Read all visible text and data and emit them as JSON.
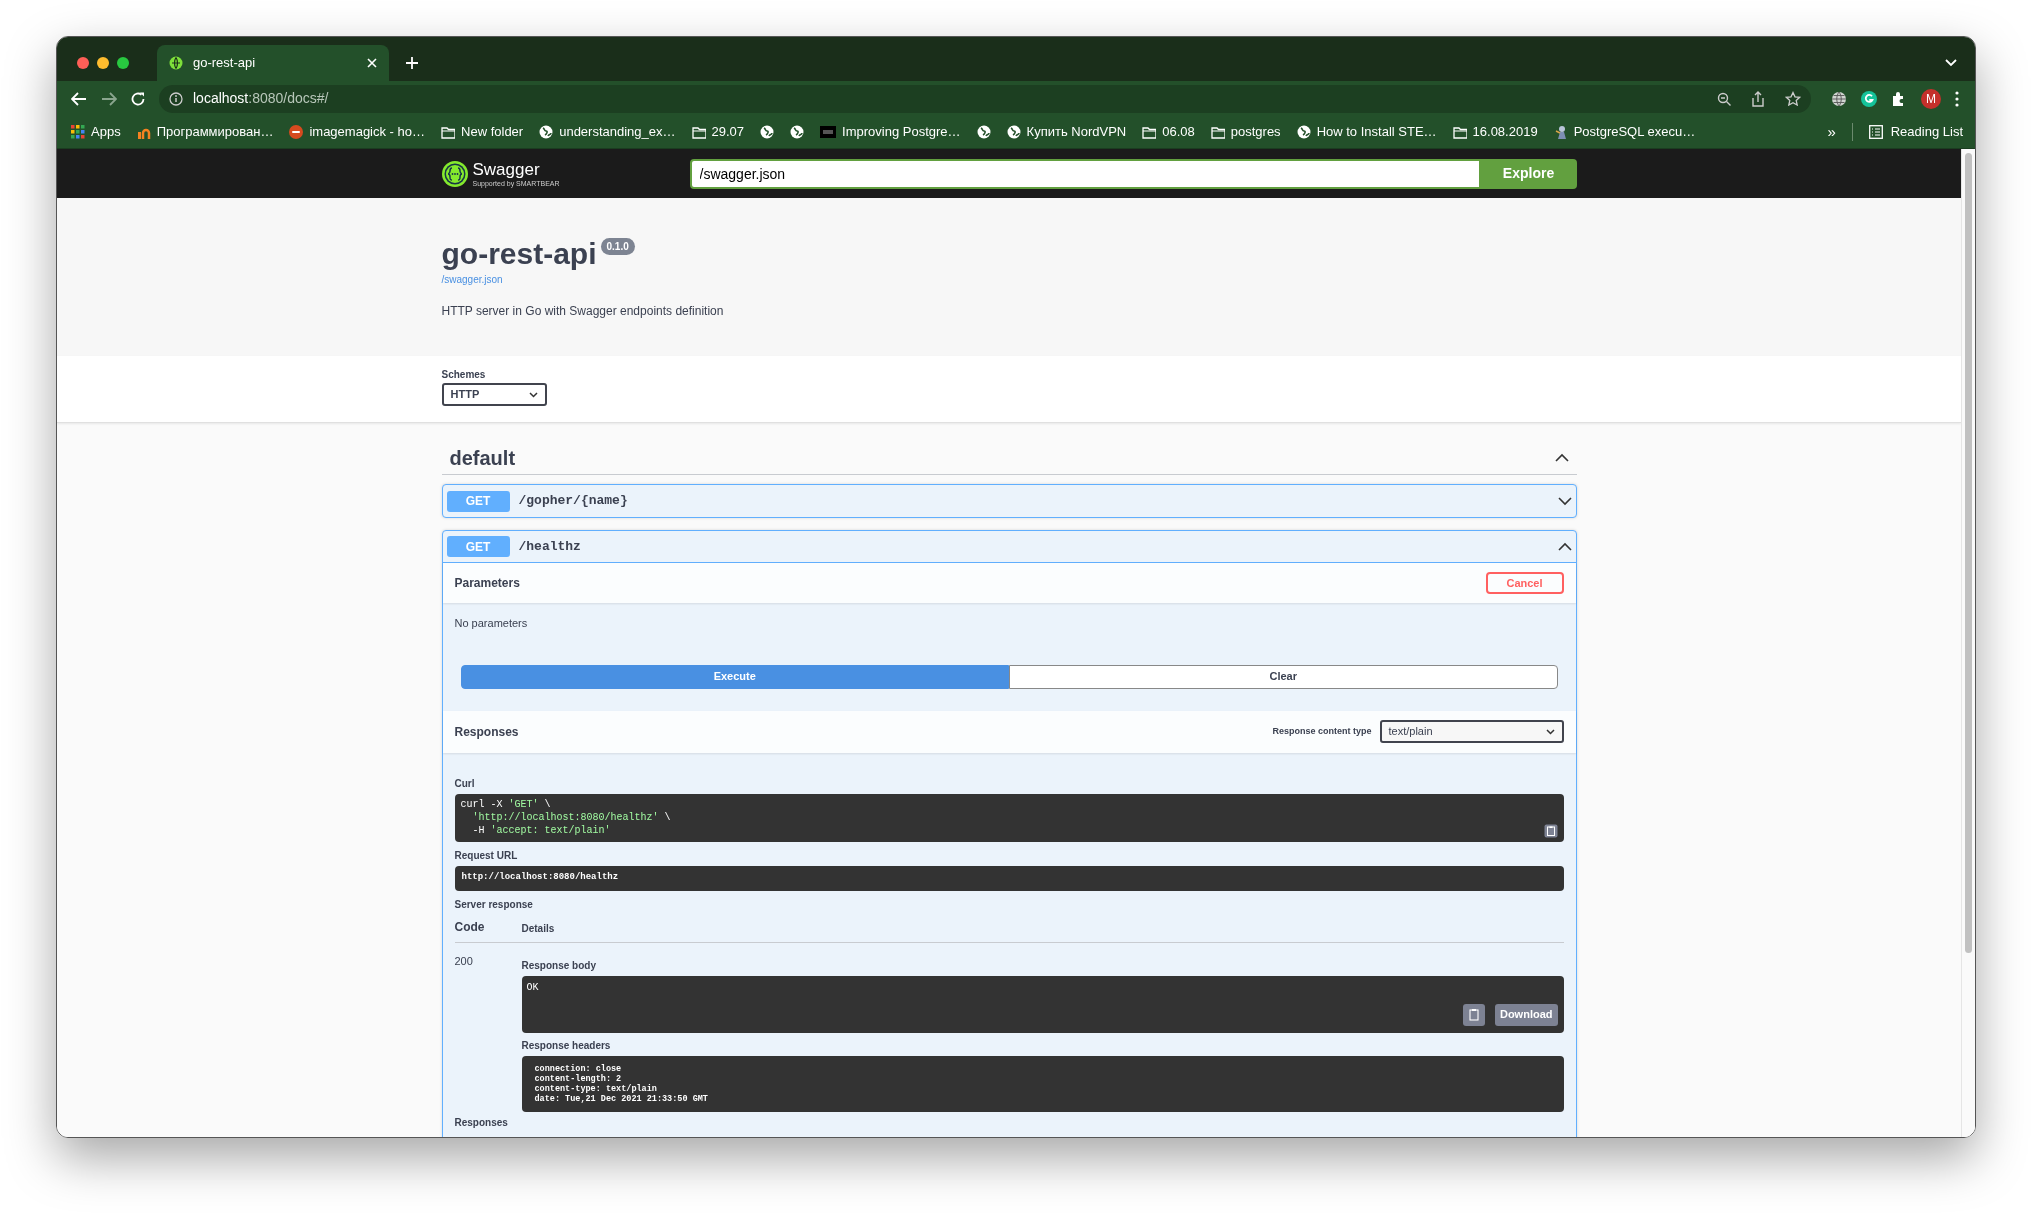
{
  "browser": {
    "tabs": [
      {
        "title": "go-rest-api",
        "selected": true
      }
    ],
    "address": {
      "host": "localhost",
      "rest": ":8080/docs#/"
    },
    "profile_initial": "M",
    "bookmarks": [
      {
        "kind": "apps",
        "label": "Apps"
      },
      {
        "kind": "site",
        "label": "Программирован…"
      },
      {
        "kind": "ask",
        "label": "imagemagick - ho…"
      },
      {
        "kind": "folder",
        "label": "New folder"
      },
      {
        "kind": "globe",
        "label": "understanding_ex…"
      },
      {
        "kind": "folder",
        "label": "29.07"
      },
      {
        "kind": "globe"
      },
      {
        "kind": "globe"
      },
      {
        "kind": "dev",
        "label": "Improving Postgre…"
      },
      {
        "kind": "globe"
      },
      {
        "kind": "globe",
        "label": "Купить NordVPN"
      },
      {
        "kind": "folder",
        "label": "06.08"
      },
      {
        "kind": "folder",
        "label": "postgres"
      },
      {
        "kind": "globe",
        "label": "How to Install STE…"
      },
      {
        "kind": "folder",
        "label": "16.08.2019"
      },
      {
        "kind": "figure",
        "label": "PostgreSQL execu…"
      }
    ],
    "overflow": "»",
    "reading_list": "Reading List"
  },
  "topbar": {
    "logo": "Swagger",
    "logo_sub": "Supported by SMARTBEAR",
    "url": "/swagger.json",
    "button": "Explore"
  },
  "info": {
    "title": "go-rest-api",
    "version": "0.1.0",
    "link": "/swagger.json",
    "description": "HTTP server in Go with Swagger endpoints definition"
  },
  "schemes": {
    "label": "Schemes",
    "value": "HTTP"
  },
  "section": {
    "title": "default",
    "expanded": true
  },
  "operations": [
    {
      "method": "GET",
      "path": "/gopher/{name}",
      "expanded": false
    },
    {
      "method": "GET",
      "path": "/healthz",
      "expanded": true,
      "detail": {
        "parameters_title": "Parameters",
        "cancel": "Cancel",
        "no_params": "No parameters",
        "execute": "Execute",
        "clear": "Clear",
        "responses_title": "Responses",
        "content_type_label": "Response content type",
        "content_type": "text/plain",
        "curl_label": "Curl",
        "curl": [
          {
            "indent": false,
            "segments": [
              {
                "kind": "plain",
                "text": "curl -X "
              },
              {
                "kind": "string",
                "text": "'GET'"
              },
              {
                "kind": "plain",
                "text": " \\"
              }
            ]
          },
          {
            "indent": true,
            "segments": [
              {
                "kind": "string",
                "text": "'http://localhost:8080/healthz'"
              },
              {
                "kind": "plain",
                "text": " \\"
              }
            ]
          },
          {
            "indent": true,
            "segments": [
              {
                "kind": "plain",
                "text": "-H "
              },
              {
                "kind": "string",
                "text": "'accept: text/plain'"
              }
            ]
          }
        ],
        "request_url_label": "Request URL",
        "request_url": "http://localhost:8080/healthz",
        "server_response_label": "Server response",
        "code_header": "Code",
        "details_header": "Details",
        "code": "200",
        "body_label": "Response body",
        "body": "OK",
        "download": "Download",
        "headers_label": "Response headers",
        "headers": [
          "connection: close",
          "content-length: 2",
          "content-type: text/plain",
          "date: Tue,21 Dec 2021 21:33:50 GMT"
        ],
        "responses_footer": "Responses"
      }
    }
  ]
}
